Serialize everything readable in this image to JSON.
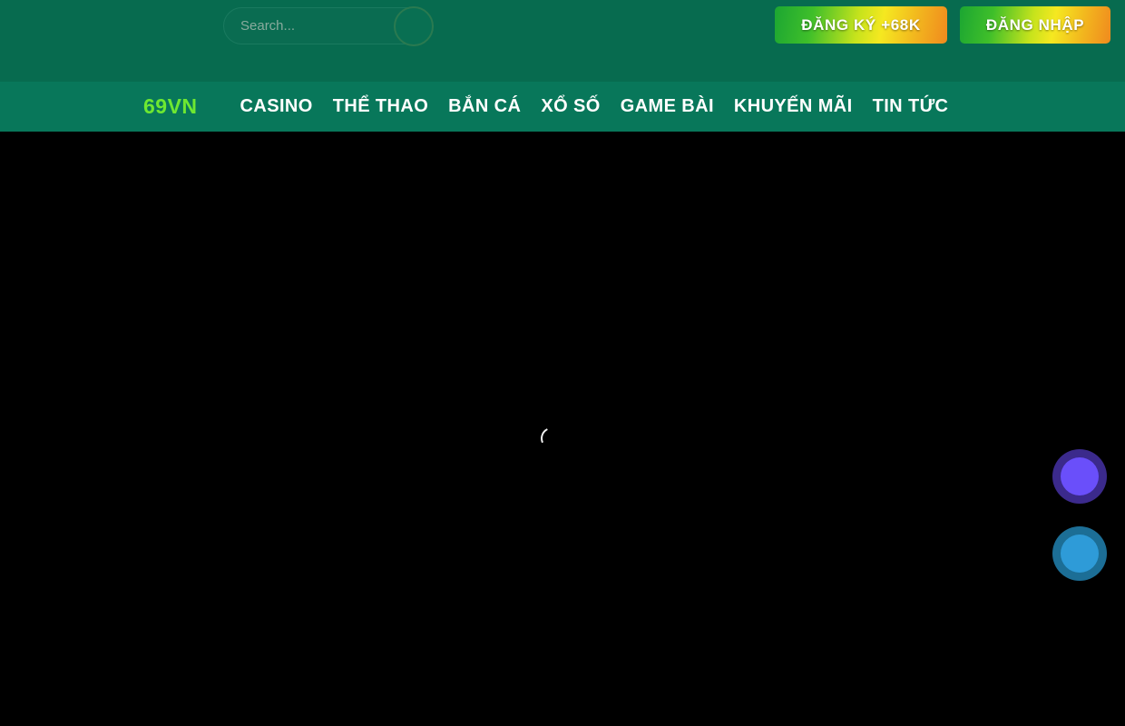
{
  "header": {
    "search": {
      "placeholder": "Search...",
      "value": "",
      "button_icon": "search-icon"
    },
    "cta": {
      "register_label": "ĐĂNG KÝ +68K",
      "login_label": "ĐĂNG NHẬP"
    }
  },
  "nav": {
    "brand": "69VN",
    "items": [
      {
        "label": "CASINO"
      },
      {
        "label": "THỂ THAO"
      },
      {
        "label": "BẮN CÁ"
      },
      {
        "label": "XỔ SỐ"
      },
      {
        "label": "GAME BÀI"
      },
      {
        "label": "KHUYẾN MÃI"
      },
      {
        "label": "TIN TỨC"
      }
    ]
  },
  "content": {
    "state": "loading",
    "spinner_icon": "loading-spinner-icon"
  },
  "floating_buttons": [
    {
      "name": "floating-action-purple",
      "icon": "circle-icon"
    },
    {
      "name": "floating-action-cyan",
      "icon": "circle-icon"
    }
  ],
  "colors": {
    "header_bg": "#076B4F",
    "nav_bg": "#08775A",
    "content_bg": "#000000",
    "brand": "#6EE831",
    "cta_gradient_start": "#1CA632",
    "cta_gradient_mid": "#F5E820",
    "cta_gradient_end": "#F08A1E",
    "fab_purple_inner": "#6A4FFA",
    "fab_purple_ring": "#3B2A8C",
    "fab_cyan_inner": "#2E9BD8",
    "fab_cyan_ring": "#1C6E96"
  }
}
